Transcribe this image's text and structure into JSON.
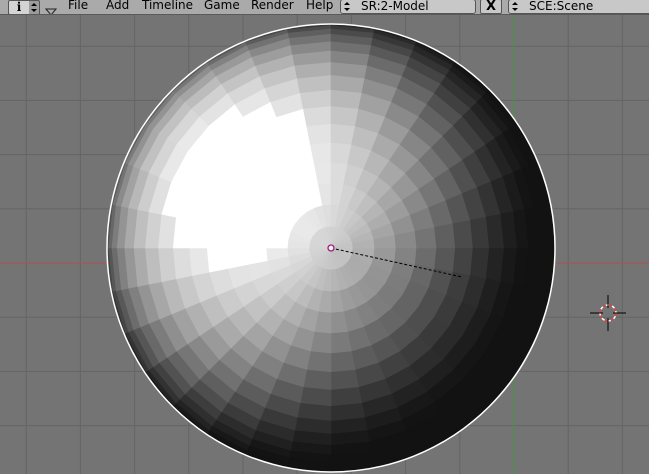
{
  "header": {
    "info_icon": "i",
    "menus": [
      "File",
      "Add",
      "Timeline",
      "Game",
      "Render",
      "Help"
    ],
    "screen_field": "SR:2-Model",
    "delete_button": "X",
    "scene_field": "SCE:Scene"
  },
  "viewport": {
    "background_color": "#747474",
    "grid_color": "#646464",
    "x_axis_color": "#b05050",
    "y_axis_color": "#3f9a3f",
    "object": "uv-sphere-shaded",
    "icons": [
      "object-origin-icon",
      "3d-cursor-icon"
    ]
  }
}
